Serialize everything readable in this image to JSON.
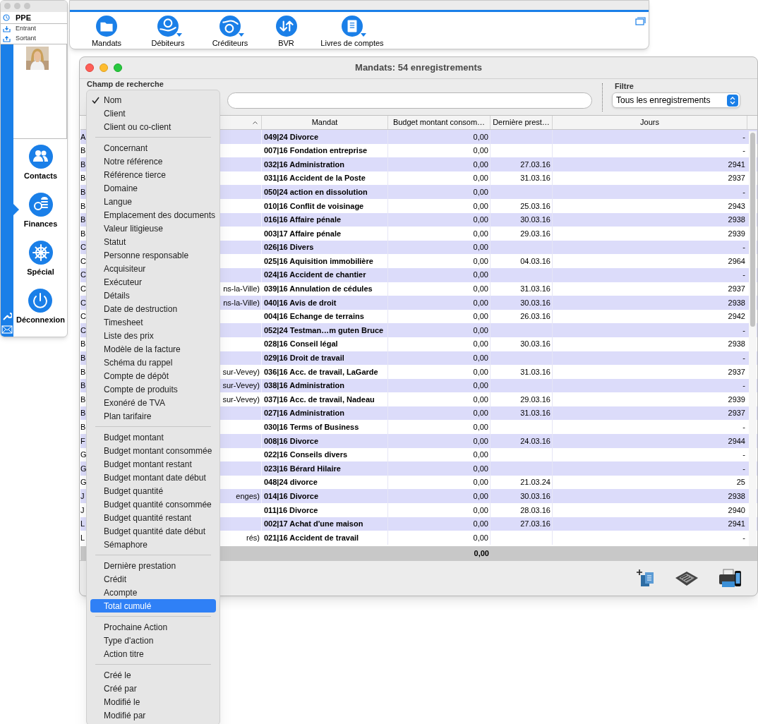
{
  "sidebar_window": {
    "title": "PPE",
    "links": [
      {
        "label": "Entrant"
      },
      {
        "label": "Sortant"
      }
    ],
    "nav": [
      {
        "label": "Contacts",
        "selected": false
      },
      {
        "label": "Finances",
        "selected": true
      },
      {
        "label": "Spécial",
        "selected": false
      },
      {
        "label": "Déconnexion",
        "selected": false
      }
    ]
  },
  "toolbar": [
    {
      "label": "Mandats",
      "has_menu": false
    },
    {
      "label": "Débiteurs",
      "has_menu": true
    },
    {
      "label": "Créditeurs",
      "has_menu": true
    },
    {
      "label": "BVR",
      "has_menu": false
    },
    {
      "label": "Livres de comptes",
      "has_menu": true
    }
  ],
  "window": {
    "title": "Mandats: 54 enregistrements"
  },
  "search": {
    "label": "Champ de recherche"
  },
  "filter": {
    "label": "Filtre",
    "value": "Tous les enregistrements"
  },
  "table": {
    "columns": [
      {
        "sorted": true
      },
      {
        "label": "Mandat",
        "sorted": false
      },
      {
        "label": "Budget montant consom…",
        "sorted": false
      },
      {
        "label": "Dernière prest…",
        "sorted": false
      },
      {
        "label": "Jours",
        "sorted": false
      }
    ],
    "rows": [
      {
        "column_1": "A",
        "mandat": "049|24 Divorce",
        "budget": "0,00",
        "jours": "-"
      },
      {
        "column_1": "B",
        "mandat": "007|16 Fondation entreprise",
        "budget": "0,00",
        "jours": "-"
      },
      {
        "column_1": "B",
        "mandat": "032|16 Administration",
        "budget": "0,00",
        "date": "27.03.16",
        "jours": "2941"
      },
      {
        "column_1": "B",
        "mandat": "031|16 Accident de la Poste",
        "budget": "0,00",
        "date": "31.03.16",
        "jours": "2937"
      },
      {
        "column_1": "B",
        "mandat": "050|24 action en dissolution",
        "budget": "0,00",
        "jours": "-"
      },
      {
        "column_1": "B",
        "mandat": "010|16 Conflit de voisinage",
        "budget": "0,00",
        "date": "25.03.16",
        "jours": "2943"
      },
      {
        "column_1": "B",
        "mandat": "016|16 Affaire pénale",
        "budget": "0,00",
        "date": "30.03.16",
        "jours": "2938"
      },
      {
        "column_1": "B",
        "mandat": "003|17 Affaire pénale",
        "budget": "0,00",
        "date": "29.03.16",
        "jours": "2939"
      },
      {
        "column_1": "C",
        "mandat": "026|16 Divers",
        "budget": "0,00",
        "jours": "-"
      },
      {
        "column_1": "C",
        "mandat": "025|16 Aquisition immobilière",
        "budget": "0,00",
        "date": "04.03.16",
        "jours": "2964"
      },
      {
        "column_1": "C",
        "mandat": "024|16 Accident de chantier",
        "budget": "0,00",
        "jours": "-"
      },
      {
        "column_1": "C",
        "column_1_end": "ns-la-Ville)",
        "mandat": "039|16 Annulation de cédules",
        "budget": "0,00",
        "date": "31.03.16",
        "jours": "2937"
      },
      {
        "column_1": "C",
        "column_1_end": "ns-la-Ville)",
        "mandat": "040|16 Avis de droit",
        "budget": "0,00",
        "date": "30.03.16",
        "jours": "2938"
      },
      {
        "column_1": "C",
        "mandat": "004|16 Echange de terrains",
        "budget": "0,00",
        "date": "26.03.16",
        "jours": "2942"
      },
      {
        "column_1": "C",
        "mandat": "052|24 Testman…m guten Bruce",
        "budget": "0,00",
        "jours": "-"
      },
      {
        "column_1": "B",
        "mandat": "028|16 Conseil légal",
        "budget": "0,00",
        "date": "30.03.16",
        "jours": "2938"
      },
      {
        "column_1": "B",
        "mandat": "029|16 Droit de travail",
        "budget": "0,00",
        "jours": "-"
      },
      {
        "column_1": "B",
        "column_1_end": "sur-Vevey)",
        "mandat": "036|16 Acc. de travail, LaGarde",
        "budget": "0,00",
        "date": "31.03.16",
        "jours": "2937"
      },
      {
        "column_1": "B",
        "column_1_end": "sur-Vevey)",
        "mandat": "038|16 Administration",
        "budget": "0,00",
        "jours": "-"
      },
      {
        "column_1": "B",
        "column_1_end": "sur-Vevey)",
        "mandat": "037|16 Acc. de travail, Nadeau",
        "budget": "0,00",
        "date": "29.03.16",
        "jours": "2939"
      },
      {
        "column_1": "B",
        "mandat": "027|16 Administration",
        "budget": "0,00",
        "date": "31.03.16",
        "jours": "2937"
      },
      {
        "column_1": "B",
        "mandat": "030|16 Terms of Business",
        "budget": "0,00",
        "jours": "-"
      },
      {
        "column_1": "F",
        "mandat": "008|16 Divorce",
        "budget": "0,00",
        "date": "24.03.16",
        "jours": "2944"
      },
      {
        "column_1": "G",
        "mandat": "022|16 Conseils divers",
        "budget": "0,00",
        "jours": "-"
      },
      {
        "column_1": "G",
        "mandat": "023|16 Bérard Hilaire",
        "budget": "0,00",
        "jours": "-"
      },
      {
        "column_1": "G",
        "mandat": "048|24 divorce",
        "budget": "0,00",
        "date": "21.03.24",
        "jours": "25"
      },
      {
        "column_1": "J",
        "column_1_end": "enges)",
        "mandat": "014|16 Divorce",
        "budget": "0,00",
        "date": "30.03.16",
        "jours": "2938"
      },
      {
        "column_1": "J",
        "mandat": "011|16 Divorce",
        "budget": "0,00",
        "date": "28.03.16",
        "jours": "2940"
      },
      {
        "column_1": "L",
        "mandat": "002|17 Achat d'une maison",
        "budget": "0,00",
        "date": "27.03.16",
        "jours": "2941"
      },
      {
        "column_1": "L",
        "column_1_end": "rés)",
        "mandat": "021|16 Accident de travail",
        "budget": "0,00",
        "jours": "-"
      }
    ],
    "total": "0,00"
  },
  "menu": {
    "sections": [
      [
        {
          "label": "Nom",
          "checked": true,
          "selected": false
        },
        {
          "label": "Client",
          "checked": false,
          "selected": false
        },
        {
          "label": "Client ou co-client",
          "checked": false,
          "selected": false
        }
      ],
      [
        {
          "label": "Concernant",
          "checked": false,
          "selected": false
        },
        {
          "label": "Notre référence",
          "checked": false,
          "selected": false
        },
        {
          "label": "Référence tierce",
          "checked": false,
          "selected": false
        },
        {
          "label": "Domaine",
          "checked": false,
          "selected": false
        },
        {
          "label": "Langue",
          "checked": false,
          "selected": false
        },
        {
          "label": "Emplacement des documents",
          "checked": false,
          "selected": false
        },
        {
          "label": "Valeur litigieuse",
          "checked": false,
          "selected": false
        },
        {
          "label": "Statut",
          "checked": false,
          "selected": false
        },
        {
          "label": "Personne responsable",
          "checked": false,
          "selected": false
        },
        {
          "label": "Acquisiteur",
          "checked": false,
          "selected": false
        },
        {
          "label": "Exécuteur",
          "checked": false,
          "selected": false
        },
        {
          "label": "Détails",
          "checked": false,
          "selected": false
        },
        {
          "label": "Date de destruction",
          "checked": false,
          "selected": false
        },
        {
          "label": "Timesheet",
          "checked": false,
          "selected": false
        },
        {
          "label": "Liste des prix",
          "checked": false,
          "selected": false
        },
        {
          "label": "Modèle de la facture",
          "checked": false,
          "selected": false
        },
        {
          "label": "Schéma du rappel",
          "checked": false,
          "selected": false
        },
        {
          "label": "Compte de dépôt",
          "checked": false,
          "selected": false
        },
        {
          "label": "Compte de produits",
          "checked": false,
          "selected": false
        },
        {
          "label": "Exonéré de TVA",
          "checked": false,
          "selected": false
        },
        {
          "label": "Plan tarifaire",
          "checked": false,
          "selected": false
        }
      ],
      [
        {
          "label": "Budget montant",
          "checked": false,
          "selected": false
        },
        {
          "label": "Budget montant consommée",
          "checked": false,
          "selected": false
        },
        {
          "label": "Budget montant restant",
          "checked": false,
          "selected": false
        },
        {
          "label": "Budget montant date début",
          "checked": false,
          "selected": false
        },
        {
          "label": "Budget quantité",
          "checked": false,
          "selected": false
        },
        {
          "label": "Budget quantité consommée",
          "checked": false,
          "selected": false
        },
        {
          "label": "Budget quantité restant",
          "checked": false,
          "selected": false
        },
        {
          "label": "Budget quantité date début",
          "checked": false,
          "selected": false
        },
        {
          "label": "Sémaphore",
          "checked": false,
          "selected": false
        }
      ],
      [
        {
          "label": "Dernière prestation",
          "checked": false,
          "selected": false
        },
        {
          "label": "Crédit",
          "checked": false,
          "selected": false
        },
        {
          "label": "Acompte",
          "checked": false,
          "selected": false
        },
        {
          "label": "Total cumulé",
          "checked": false,
          "selected": true
        }
      ],
      [
        {
          "label": "Prochaine Action",
          "checked": false,
          "selected": false
        },
        {
          "label": "Type d'action",
          "checked": false,
          "selected": false
        },
        {
          "label": "Action titre",
          "checked": false,
          "selected": false
        }
      ],
      [
        {
          "label": "Créé le",
          "checked": false,
          "selected": false
        },
        {
          "label": "Créé par",
          "checked": false,
          "selected": false
        },
        {
          "label": "Modifié le",
          "checked": false,
          "selected": false
        },
        {
          "label": "Modifié par",
          "checked": false,
          "selected": false
        }
      ]
    ]
  }
}
